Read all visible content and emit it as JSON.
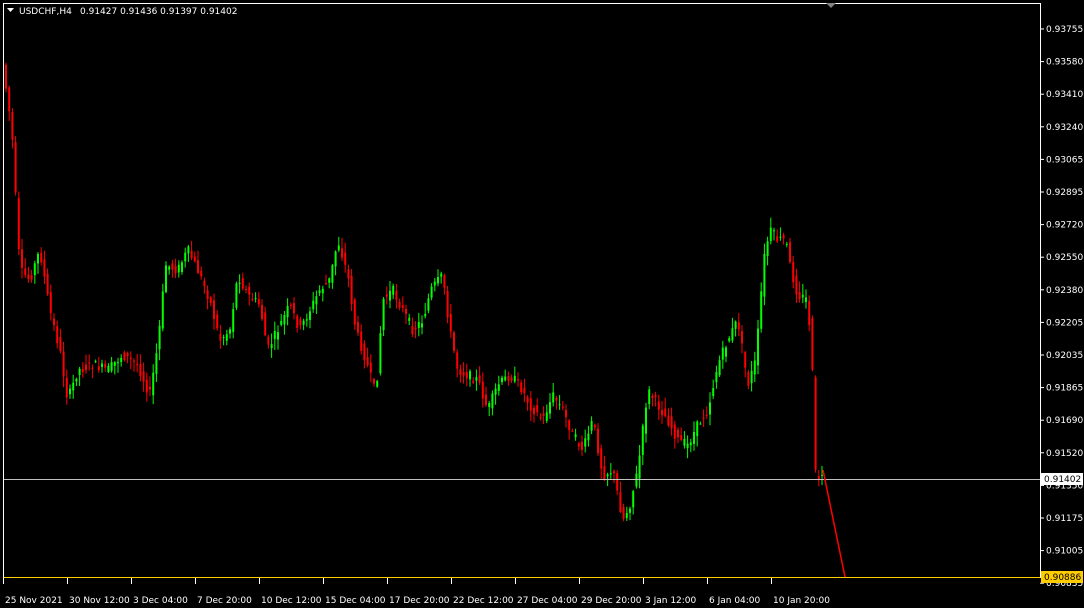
{
  "header": {
    "symbol": "USDCHF,H4",
    "ohlc": "0.91427 0.91436 0.91397 0.91402"
  },
  "price_badge": {
    "value": "0.91402",
    "bg": "#ffffff",
    "fg": "#000000"
  },
  "target_badge": {
    "value": "0.90886",
    "bg": "#ffcc00",
    "fg": "#000000"
  },
  "colors": {
    "background": "#000000",
    "frame": "#ffffff",
    "bull": "#00ff00",
    "bear": "#ff0000",
    "price_line": "#c0c0c0",
    "target_line": "#ffcc00"
  },
  "icons": {
    "dropdown": "triangle-down-icon",
    "scroll_marker": "triangle-down-icon"
  },
  "chart_data": {
    "type": "candlestick",
    "title": "USDCHF,H4",
    "ylim": [
      0.90835,
      0.9393
    ],
    "y_ticks": [
      "0.93755",
      "0.93580",
      "0.93410",
      "0.93240",
      "0.93065",
      "0.92895",
      "0.92720",
      "0.92550",
      "0.92380",
      "0.92205",
      "0.92035",
      "0.91865",
      "0.91690",
      "0.91520",
      "0.91350",
      "0.91175",
      "0.91005",
      "0.90835"
    ],
    "x_ticks": [
      "25 Nov 2021",
      "30 Nov 12:00",
      "3 Dec 04:00",
      "7 Dec 20:00",
      "10 Dec 12:00",
      "15 Dec 04:00",
      "17 Dec 20:00",
      "22 Dec 12:00",
      "27 Dec 04:00",
      "29 Dec 20:00",
      "3 Jan 12:00",
      "6 Jan 04:00",
      "10 Jan 20:00"
    ],
    "current_price": 0.91402,
    "forecast_line": {
      "from": 0.91427,
      "to": 0.90886
    }
  }
}
